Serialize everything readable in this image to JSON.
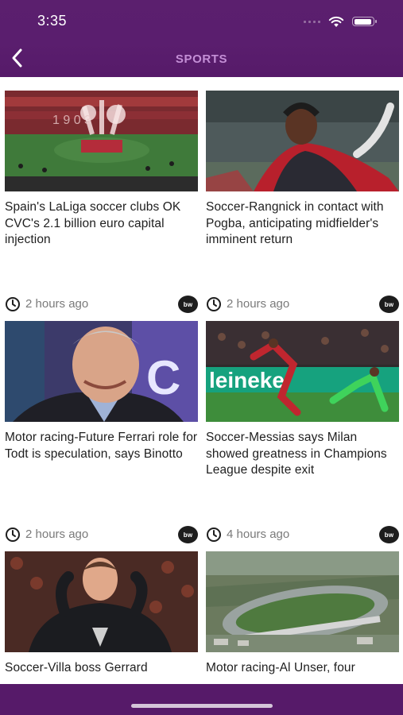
{
  "status_bar": {
    "time": "3:35"
  },
  "header": {
    "title": "SPORTS"
  },
  "articles": [
    {
      "title": "Spain's LaLiga soccer clubs OK CVC's 2.1 billion euro capital injection",
      "time": "2 hours ago",
      "source": "bw",
      "image": "stadium-celebration"
    },
    {
      "title": "Soccer-Rangnick in contact with Pogba, anticipating midfielder's imminent return",
      "time": "2 hours ago",
      "source": "bw",
      "image": "pogba-portrait"
    },
    {
      "title": "Motor racing-Future Ferrari role for Todt is speculation, says Binotto",
      "time": "2 hours ago",
      "source": "bw",
      "image": "todt-portrait"
    },
    {
      "title": "Soccer-Messias says Milan showed greatness in Champions League despite exit",
      "time": "4 hours ago",
      "source": "bw",
      "image": "milan-match"
    },
    {
      "title": "Soccer-Villa boss Gerrard",
      "time": "",
      "source": "",
      "image": "gerrard-celebration"
    },
    {
      "title": "Motor racing-Al Unser, four",
      "time": "",
      "source": "",
      "image": "speedway-aerial"
    }
  ],
  "colors": {
    "header": "#5a1e6e",
    "title_accent": "#c48fd6",
    "text": "#1e1e1e",
    "meta": "#7a7a7a"
  }
}
